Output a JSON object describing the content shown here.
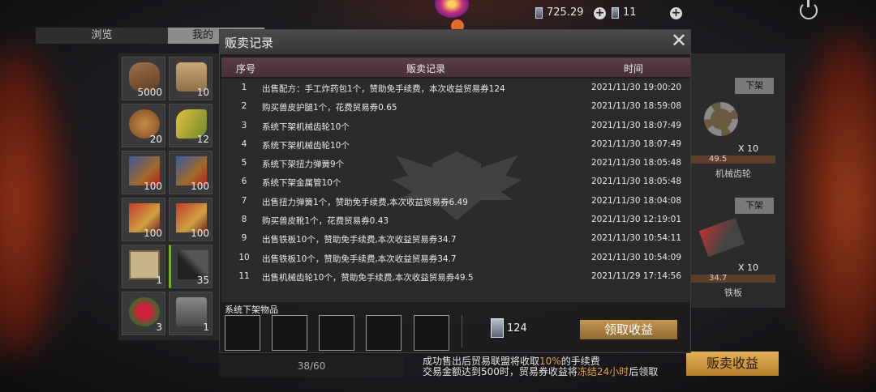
{
  "top_bar": {
    "currency_value": "725.29",
    "ticket_value": "11"
  },
  "background_tabs": [
    "浏览",
    "我的"
  ],
  "inventory": {
    "items": [
      {
        "icon": "logs-icon",
        "count": "5000"
      },
      {
        "icon": "straw-bale-icon",
        "count": "10"
      },
      {
        "icon": "potato-icon",
        "count": "20"
      },
      {
        "icon": "corn-icon",
        "count": "12"
      },
      {
        "icon": "ammo-box-icon",
        "count": "100"
      },
      {
        "icon": "ammo-box-icon",
        "count": "100"
      },
      {
        "icon": "shotgun-shells-icon",
        "count": "100"
      },
      {
        "icon": "shotgun-shells-icon",
        "count": "100"
      },
      {
        "icon": "blueprint-icon",
        "count": "1"
      },
      {
        "icon": "rifle-icon",
        "count": "35"
      },
      {
        "icon": "berries-icon",
        "count": "3"
      },
      {
        "icon": "metal-parts-icon",
        "count": "1"
      }
    ],
    "capacity": "38/60"
  },
  "right_panel": {
    "items": [
      {
        "action": "下架",
        "price": "49.5",
        "qty": "X 10",
        "name": "机械齿轮"
      },
      {
        "action": "下架",
        "price": "34.7",
        "qty": "X 10",
        "name": "铁板"
      }
    ],
    "sell_income_button": "贩卖收益"
  },
  "modal": {
    "title": "贩卖记录",
    "columns": {
      "no": "序号",
      "record": "贩卖记录",
      "time": "时间"
    },
    "rows": [
      {
        "no": "1",
        "record": "出售配方：手工炸药包1个，赞助免手续费，本次收益贸易券124",
        "time": "2021/11/30 19:00:20"
      },
      {
        "no": "2",
        "record": "购买兽皮护腿1个，花费贸易券0.65",
        "time": "2021/11/30 18:59:08"
      },
      {
        "no": "3",
        "record": "系统下架机械齿轮10个",
        "time": "2021/11/30 18:07:49"
      },
      {
        "no": "4",
        "record": "系统下架机械齿轮10个",
        "time": "2021/11/30 18:07:49"
      },
      {
        "no": "5",
        "record": "系统下架扭力弹簧9个",
        "time": "2021/11/30 18:05:48"
      },
      {
        "no": "6",
        "record": "系统下架金属管10个",
        "time": "2021/11/30 18:05:48"
      },
      {
        "no": "7",
        "record": "出售扭力弹簧1个，赞助免手续费,本次收益贸易券6.49",
        "time": "2021/11/30 18:04:08"
      },
      {
        "no": "8",
        "record": "购买兽皮靴1个，花费贸易券0.43",
        "time": "2021/11/30 12:19:01"
      },
      {
        "no": "9",
        "record": "出售铁板10个，赞助免手续费,本次收益贸易券34.7",
        "time": "2021/11/30 10:54:11"
      },
      {
        "no": "10",
        "record": "出售铁板10个，赞助免手续费,本次收益贸易券34.7",
        "time": "2021/11/30 10:54:09"
      },
      {
        "no": "11",
        "record": "出售机械齿轮10个，赞助免手续费,本次收益贸易券49.5",
        "time": "2021/11/29 17:14:56"
      }
    ],
    "system_removed_label": "系统下架物品",
    "ticket_amount": "124",
    "collect_button": "领取收益"
  },
  "notice": {
    "line1_before": "成功售出后贸易联盟将收取",
    "line1_highlight": "10%",
    "line1_after": "的手续费",
    "line2_before": "交易金额达到500时，贸易券收益将",
    "line2_highlight": "冻结24小时",
    "line2_after": "后领取"
  },
  "colors": {
    "accent_gold": "#e3a33a",
    "table_header": "#5a3c44"
  }
}
